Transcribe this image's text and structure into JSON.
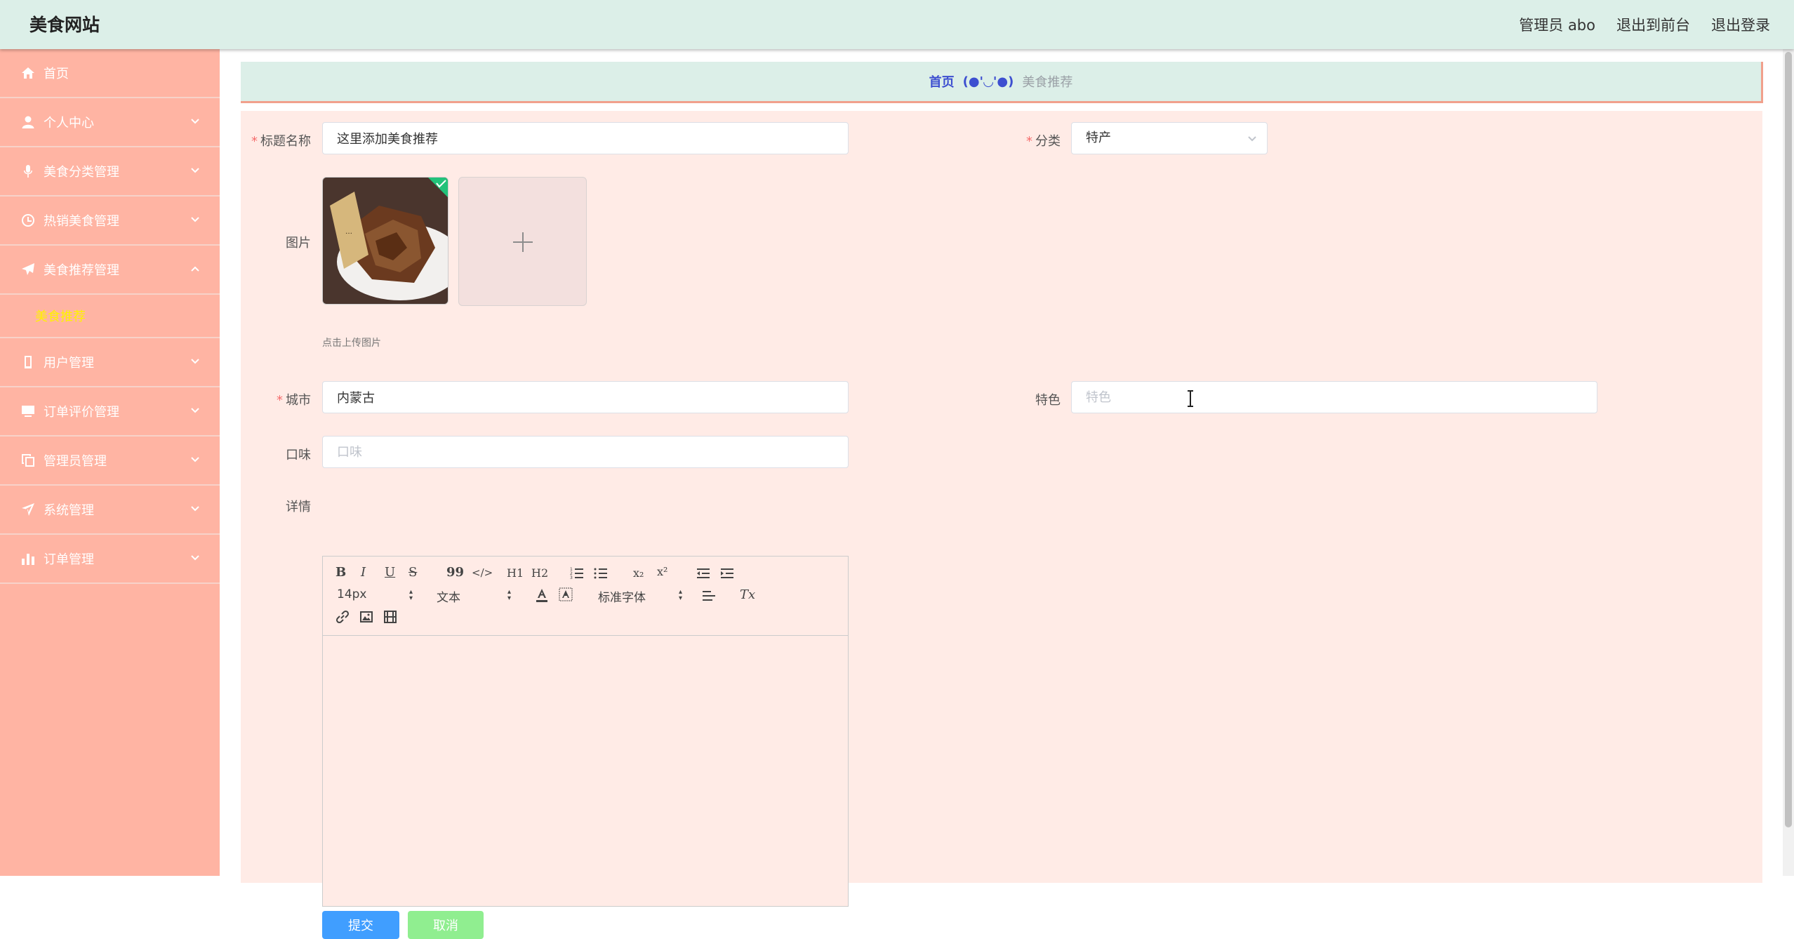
{
  "header": {
    "brand": "美食网站",
    "admin_label": "管理员 abo",
    "to_front": "退出到前台",
    "logout": "退出登录"
  },
  "sidebar": {
    "items": [
      {
        "label": "首页",
        "icon": "home-icon"
      },
      {
        "label": "个人中心",
        "icon": "user-icon"
      },
      {
        "label": "美食分类管理",
        "icon": "microphone-icon"
      },
      {
        "label": "热销美食管理",
        "icon": "clock-icon"
      },
      {
        "label": "美食推荐管理",
        "icon": "send-icon",
        "expanded": true
      },
      {
        "label": "用户管理",
        "icon": "mobile-icon"
      },
      {
        "label": "订单评价管理",
        "icon": "monitor-icon"
      },
      {
        "label": "管理员管理",
        "icon": "copy-icon"
      },
      {
        "label": "系统管理",
        "icon": "location-icon"
      },
      {
        "label": "订单管理",
        "icon": "chart-icon"
      }
    ],
    "sub_item": "美食推荐",
    "accent_color": "#fff200",
    "bg_color": "#ffb4a3"
  },
  "breadcrumb": {
    "home": "首页",
    "separator": "(●'◡'●)",
    "current": "美食推荐"
  },
  "form": {
    "title_label": "标题名称",
    "title_value": "这里添加美食推荐",
    "category_label": "分类",
    "category_value": "特产",
    "image_label": "图片",
    "upload_hint": "点击上传图片",
    "city_label": "城市",
    "city_value": "内蒙古",
    "feature_label": "特色",
    "feature_placeholder": "特色",
    "taste_label": "口味",
    "taste_placeholder": "口味",
    "detail_label": "详情"
  },
  "editor": {
    "font_size": "14px",
    "text_style": "文本",
    "font_family": "标准字体",
    "tools": {
      "bold": "B",
      "italic": "I",
      "underline": "U",
      "strike": "S",
      "quote": "99",
      "code": "</>",
      "h1": "H1",
      "h2": "H2",
      "subscript": "x₂",
      "superscript": "x²",
      "clear": "Tx"
    }
  },
  "buttons": {
    "submit": "提交",
    "cancel": "取消"
  }
}
